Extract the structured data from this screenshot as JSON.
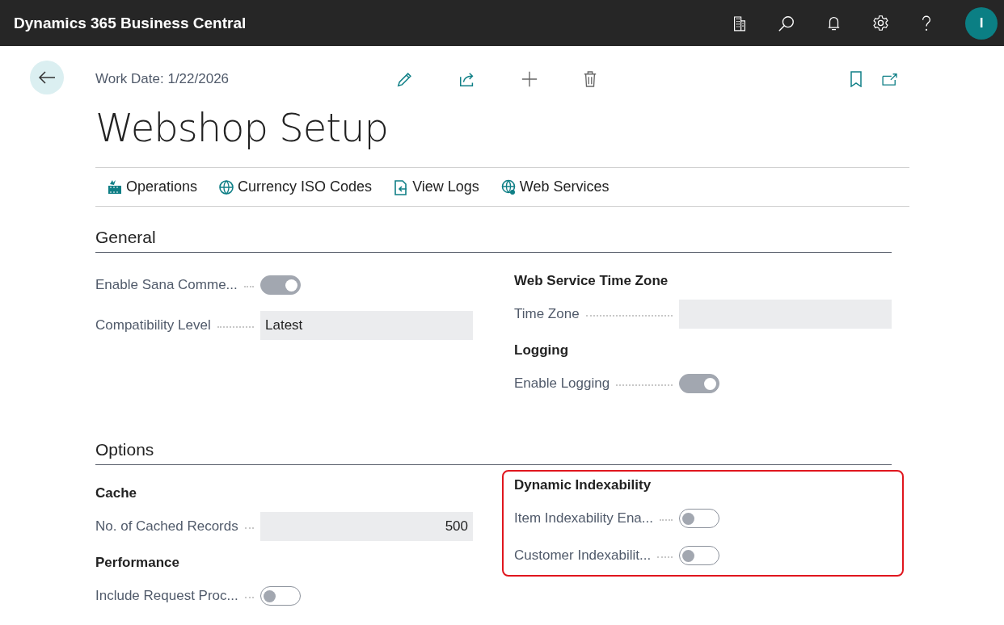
{
  "app_bar": {
    "title": "Dynamics 365 Business Central",
    "avatar_initial": "I"
  },
  "header": {
    "work_date": "Work Date: 1/22/2026",
    "title": "Webshop Setup"
  },
  "actions": [
    {
      "label": "Operations"
    },
    {
      "label": "Currency ISO Codes"
    },
    {
      "label": "View Logs"
    },
    {
      "label": "Web Services"
    }
  ],
  "sections": [
    {
      "title": "General",
      "columns": [
        [
          {
            "kind": "toggle",
            "label": "Enable Sana Comme...",
            "on": true
          },
          {
            "kind": "text",
            "label": "Compatibility Level",
            "value": "Latest"
          }
        ],
        [
          {
            "kind": "group",
            "label": "Web Service Time Zone",
            "highlighted": false,
            "items": [
              {
                "kind": "text",
                "label": "Time Zone",
                "value": ""
              }
            ]
          },
          {
            "kind": "group",
            "label": "Logging",
            "highlighted": false,
            "items": [
              {
                "kind": "toggle",
                "label": "Enable Logging",
                "on": true
              }
            ]
          }
        ]
      ]
    },
    {
      "title": "Options",
      "columns": [
        [
          {
            "kind": "group",
            "label": "Cache",
            "highlighted": false,
            "items": [
              {
                "kind": "number",
                "label": "No. of Cached Records",
                "value": "500"
              }
            ]
          },
          {
            "kind": "group",
            "label": "Performance",
            "highlighted": false,
            "items": [
              {
                "kind": "toggle",
                "label": "Include Request Proc...",
                "on": false
              }
            ]
          }
        ],
        [
          {
            "kind": "group",
            "label": "Dynamic Indexability",
            "highlighted": true,
            "items": [
              {
                "kind": "toggle",
                "label": "Item Indexability Ena...",
                "on": false
              },
              {
                "kind": "toggle",
                "label": "Customer Indexabilit...",
                "on": false
              }
            ]
          }
        ]
      ]
    }
  ]
}
